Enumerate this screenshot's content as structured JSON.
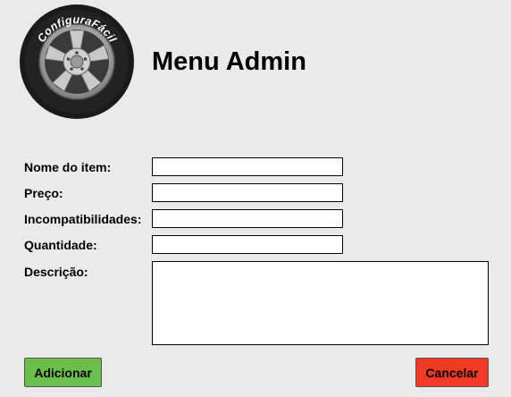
{
  "logo": {
    "text": "ConfiguraFácil",
    "icon": "wheel-icon"
  },
  "header": {
    "title": "Menu Admin"
  },
  "form": {
    "item_name_label": "Nome do item:",
    "item_name_value": "",
    "price_label": "Preço:",
    "price_value": "",
    "incompat_label": "Incompatibilidades:",
    "incompat_value": "",
    "quantity_label": "Quantidade:",
    "quantity_value": "",
    "description_label": "Descrição:",
    "description_value": ""
  },
  "actions": {
    "add_label": "Adicionar",
    "cancel_label": "Cancelar"
  },
  "colors": {
    "background": "#eaeaea",
    "add_button": "#6abf4b",
    "cancel_button": "#f03a24"
  }
}
